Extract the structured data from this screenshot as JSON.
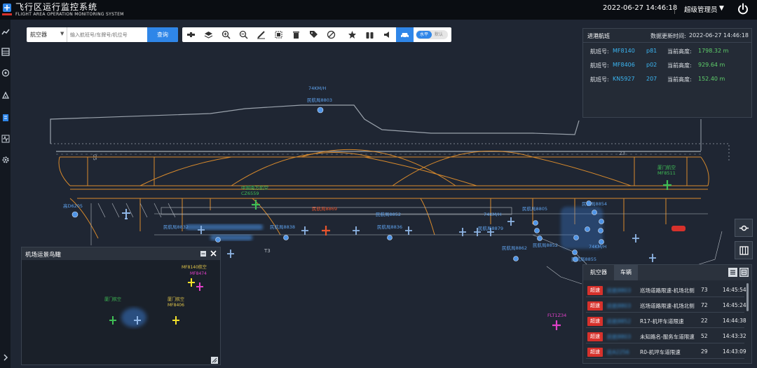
{
  "header": {
    "title": "飞行区运行监控系统",
    "subtitle": "FLIGHT AREA OPERATION MONITORING SYSTEM",
    "datetime": "2022-06-27 14:46:18",
    "user": "超级管理员"
  },
  "search": {
    "type_value": "航空器",
    "placeholder": "输入航班号/车牌号/机位号",
    "button": "查询"
  },
  "toolbar": {
    "icons": [
      "runway-icon",
      "layers-icon",
      "zoom-in-icon",
      "zoom-out-icon",
      "ruler-icon",
      "select-area-icon",
      "trash-icon",
      "tag-icon",
      "no-entry-icon",
      "star-icon",
      "binoculars-icon",
      "speaker-icon",
      "car-icon"
    ],
    "toggle_on": "水平",
    "toggle_off": "默认"
  },
  "info_panel": {
    "title": "进港航班",
    "update_label": "数据更新时间:",
    "update_time": "2022-06-27 14:46:18",
    "rows": [
      {
        "flight_label": "航班号:",
        "flight": "MF8140",
        "stand": "p81",
        "alt_label": "当前高度:",
        "altitude": "1798.32 m"
      },
      {
        "flight_label": "航班号:",
        "flight": "MF8406",
        "stand": "p02",
        "alt_label": "当前高度:",
        "altitude": "929.64 m"
      },
      {
        "flight_label": "航班号:",
        "flight": "KN5927",
        "stand": "207",
        "alt_label": "当前高度:",
        "altitude": "152.40 m"
      }
    ]
  },
  "birdseye": {
    "title": "机场运景鸟瞰",
    "labels": {
      "l1": "MF8140航空",
      "l2": "MF8474",
      "l3": "厦门航空",
      "l4": "MF8406",
      "l5": "厦门航空"
    }
  },
  "map_labels": {
    "speed": "74KM/H",
    "vehicle_top": "民航局8803",
    "runway_05": "05",
    "runway_23": "23",
    "xiamen": "厦门航空",
    "mf8511": "MF8511",
    "cz6559": "CZ6559",
    "south_china": "中国南方航空",
    "west": "高D6205",
    "t3": "T3",
    "flt": "FLT1Z34",
    "hui": "民航局8803",
    "m1": "民航局8832",
    "m2": "民航局8838",
    "m3": "民航局8836",
    "m4": "民航局8879",
    "m5": "民航局8852",
    "m6": "民航局8862",
    "m7": "民航局8852",
    "m8": "民航局8854",
    "m9": "民航局8805",
    "m10": "74KM/H",
    "m11": "74KM/H",
    "m12": "民航局8855",
    "m13": "民航局8869"
  },
  "alarm_panel": {
    "tab_aircraft": "航空器",
    "tab_vehicle": "车辆",
    "rows": [
      {
        "badge": "超速",
        "plate": "民航8803",
        "road": "巡场道路限速-机场北侧",
        "speed": "73",
        "time": "14:45:54"
      },
      {
        "badge": "超速",
        "plate": "民航8803",
        "road": "巡场道路限速-机场北侧",
        "speed": "72",
        "time": "14:45:24"
      },
      {
        "badge": "超速",
        "plate": "民航8852",
        "road": "R17-机坪车道限速",
        "speed": "22",
        "time": "14:44:38"
      },
      {
        "badge": "超速",
        "plate": "民航8803",
        "road": "未知路名-服务车道限速",
        "speed": "52",
        "time": "14:43:32"
      },
      {
        "badge": "超速",
        "plate": "民A2256",
        "road": "R0-机坪车道限速",
        "speed": "29",
        "time": "14:43:09"
      }
    ]
  },
  "colors": {
    "taxiway": "#d88a2c",
    "accent": "#2f86e8",
    "alarm": "#d7312b",
    "flight_text": "#3bb6f2",
    "altitude_text": "#5fd06b"
  }
}
